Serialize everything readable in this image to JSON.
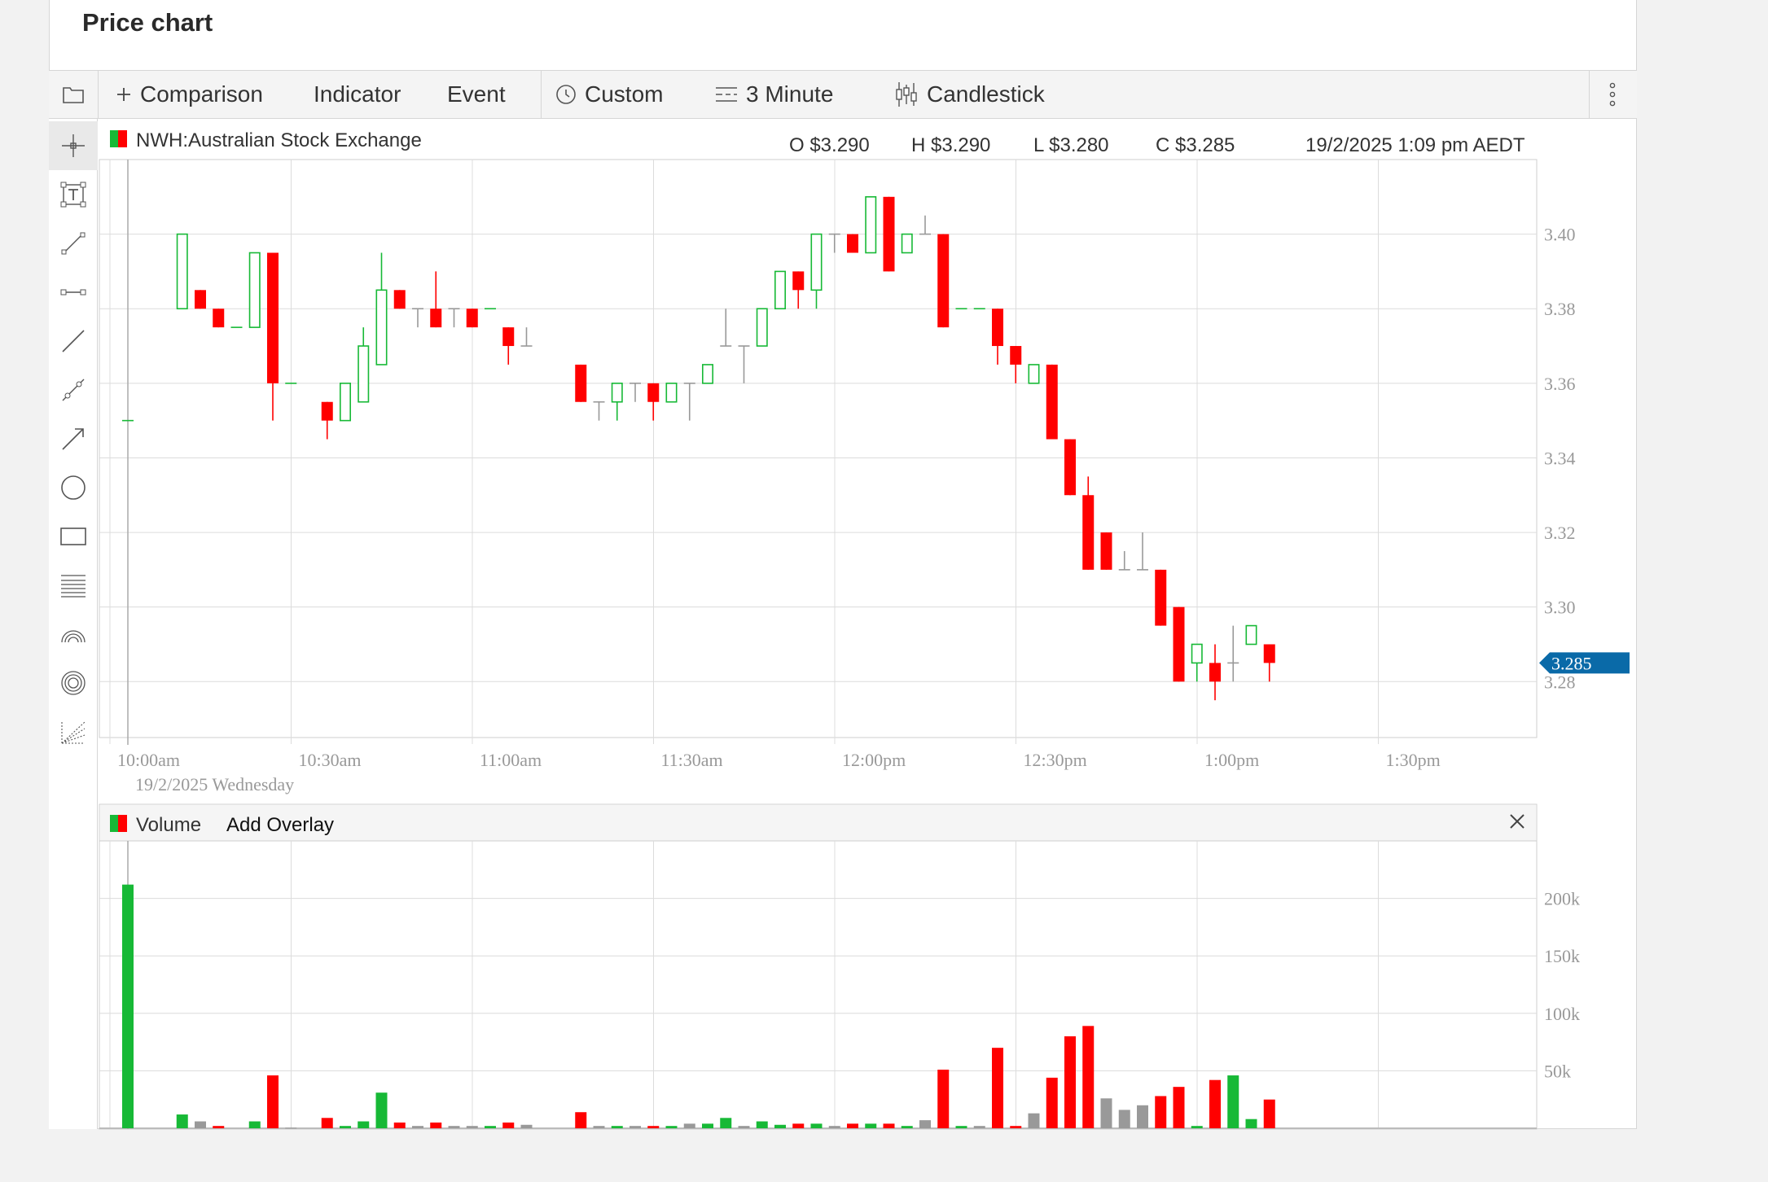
{
  "page": {
    "title": "Price chart"
  },
  "toolbar": {
    "comparison": "Comparison",
    "indicator": "Indicator",
    "event": "Event",
    "custom": "Custom",
    "interval": "3 Minute",
    "chart_type": "Candlestick"
  },
  "tools": [
    "crosshair-icon",
    "annotation-icon",
    "line-segment-icon",
    "horizontal-segment-icon",
    "trend-line-icon",
    "channel-icon",
    "arrow-icon",
    "ellipse-icon",
    "rectangle-icon",
    "fibonacci-retracement-icon",
    "fibonacci-arc-icon",
    "fibonacci-circle-icon",
    "fibonacci-fan-icon"
  ],
  "legend": {
    "symbol": "NWH:Australian Stock Exchange",
    "open": "O $3.290",
    "high": "H $3.290",
    "low": "L $3.280",
    "close": "C $3.285",
    "datetime": "19/2/2025 1:09 pm AEDT"
  },
  "volume_panel": {
    "label": "Volume",
    "add_overlay": "Add Overlay"
  },
  "colors": {
    "up": "#17b936",
    "down": "#ff0000",
    "flat": "#999999",
    "badge": "#0a6aa8"
  },
  "chart_data": [
    {
      "type": "candlestick",
      "title": "NWH:Australian Stock Exchange",
      "ylim": [
        3.265,
        3.42
      ],
      "yticks": [
        "3.28",
        "3.30",
        "3.32",
        "3.34",
        "3.36",
        "3.38",
        "3.40"
      ],
      "xticks": [
        {
          "t": 600,
          "label": "10:00am"
        },
        {
          "t": 630,
          "label": "10:30am"
        },
        {
          "t": 660,
          "label": "11:00am"
        },
        {
          "t": 690,
          "label": "11:30am"
        },
        {
          "t": 720,
          "label": "12:00pm"
        },
        {
          "t": 750,
          "label": "12:30pm"
        },
        {
          "t": 780,
          "label": "1:00pm"
        },
        {
          "t": 810,
          "label": "1:30pm"
        }
      ],
      "date_label": "19/2/2025 Wednesday",
      "last_price": "3.285",
      "last_value": 3.285,
      "candles": [
        {
          "t": 600,
          "o": 3.35,
          "h": 3.35,
          "l": 3.35,
          "c": 3.35
        },
        {
          "t": 609,
          "o": 3.38,
          "h": 3.4,
          "l": 3.38,
          "c": 3.4
        },
        {
          "t": 612,
          "o": 3.385,
          "h": 3.385,
          "l": 3.38,
          "c": 3.38
        },
        {
          "t": 615,
          "o": 3.38,
          "h": 3.38,
          "l": 3.375,
          "c": 3.375
        },
        {
          "t": 618,
          "o": 3.375,
          "h": 3.375,
          "l": 3.375,
          "c": 3.375
        },
        {
          "t": 621,
          "o": 3.375,
          "h": 3.395,
          "l": 3.375,
          "c": 3.395
        },
        {
          "t": 624,
          "o": 3.395,
          "h": 3.395,
          "l": 3.35,
          "c": 3.36
        },
        {
          "t": 627,
          "o": 3.36,
          "h": 3.36,
          "l": 3.36,
          "c": 3.36
        },
        {
          "t": 633,
          "o": 3.355,
          "h": 3.355,
          "l": 3.345,
          "c": 3.35
        },
        {
          "t": 636,
          "o": 3.35,
          "h": 3.36,
          "l": 3.35,
          "c": 3.36
        },
        {
          "t": 639,
          "o": 3.355,
          "h": 3.375,
          "l": 3.355,
          "c": 3.37
        },
        {
          "t": 642,
          "o": 3.365,
          "h": 3.395,
          "l": 3.365,
          "c": 3.385
        },
        {
          "t": 645,
          "o": 3.385,
          "h": 3.385,
          "l": 3.38,
          "c": 3.38
        },
        {
          "t": 648,
          "o": 3.38,
          "h": 3.38,
          "l": 3.375,
          "c": 3.38
        },
        {
          "t": 651,
          "o": 3.38,
          "h": 3.39,
          "l": 3.375,
          "c": 3.375
        },
        {
          "t": 654,
          "o": 3.38,
          "h": 3.38,
          "l": 3.375,
          "c": 3.38
        },
        {
          "t": 657,
          "o": 3.38,
          "h": 3.38,
          "l": 3.375,
          "c": 3.375
        },
        {
          "t": 660,
          "o": 3.38,
          "h": 3.38,
          "l": 3.38,
          "c": 3.38
        },
        {
          "t": 663,
          "o": 3.375,
          "h": 3.375,
          "l": 3.365,
          "c": 3.37
        },
        {
          "t": 666,
          "o": 3.37,
          "h": 3.375,
          "l": 3.37,
          "c": 3.37
        },
        {
          "t": 675,
          "o": 3.365,
          "h": 3.365,
          "l": 3.355,
          "c": 3.355
        },
        {
          "t": 678,
          "o": 3.355,
          "h": 3.355,
          "l": 3.35,
          "c": 3.355
        },
        {
          "t": 681,
          "o": 3.355,
          "h": 3.36,
          "l": 3.35,
          "c": 3.36
        },
        {
          "t": 684,
          "o": 3.36,
          "h": 3.36,
          "l": 3.355,
          "c": 3.36
        },
        {
          "t": 687,
          "o": 3.36,
          "h": 3.36,
          "l": 3.35,
          "c": 3.355
        },
        {
          "t": 690,
          "o": 3.355,
          "h": 3.36,
          "l": 3.355,
          "c": 3.36
        },
        {
          "t": 693,
          "o": 3.36,
          "h": 3.36,
          "l": 3.35,
          "c": 3.36
        },
        {
          "t": 696,
          "o": 3.36,
          "h": 3.365,
          "l": 3.36,
          "c": 3.365
        },
        {
          "t": 699,
          "o": 3.37,
          "h": 3.38,
          "l": 3.37,
          "c": 3.37
        },
        {
          "t": 702,
          "o": 3.37,
          "h": 3.37,
          "l": 3.36,
          "c": 3.37
        },
        {
          "t": 705,
          "o": 3.37,
          "h": 3.38,
          "l": 3.37,
          "c": 3.38
        },
        {
          "t": 708,
          "o": 3.38,
          "h": 3.39,
          "l": 3.38,
          "c": 3.39
        },
        {
          "t": 711,
          "o": 3.39,
          "h": 3.39,
          "l": 3.38,
          "c": 3.385
        },
        {
          "t": 714,
          "o": 3.385,
          "h": 3.4,
          "l": 3.38,
          "c": 3.4
        },
        {
          "t": 717,
          "o": 3.4,
          "h": 3.4,
          "l": 3.395,
          "c": 3.4
        },
        {
          "t": 720,
          "o": 3.4,
          "h": 3.4,
          "l": 3.395,
          "c": 3.395
        },
        {
          "t": 723,
          "o": 3.395,
          "h": 3.41,
          "l": 3.395,
          "c": 3.41
        },
        {
          "t": 726,
          "o": 3.41,
          "h": 3.41,
          "l": 3.39,
          "c": 3.39
        },
        {
          "t": 729,
          "o": 3.395,
          "h": 3.4,
          "l": 3.395,
          "c": 3.4
        },
        {
          "t": 732,
          "o": 3.4,
          "h": 3.405,
          "l": 3.4,
          "c": 3.4
        },
        {
          "t": 735,
          "o": 3.4,
          "h": 3.4,
          "l": 3.375,
          "c": 3.375
        },
        {
          "t": 738,
          "o": 3.38,
          "h": 3.38,
          "l": 3.38,
          "c": 3.38
        },
        {
          "t": 741,
          "o": 3.38,
          "h": 3.38,
          "l": 3.38,
          "c": 3.38
        },
        {
          "t": 744,
          "o": 3.38,
          "h": 3.38,
          "l": 3.365,
          "c": 3.37
        },
        {
          "t": 747,
          "o": 3.37,
          "h": 3.37,
          "l": 3.36,
          "c": 3.365
        },
        {
          "t": 750,
          "o": 3.36,
          "h": 3.365,
          "l": 3.36,
          "c": 3.365
        },
        {
          "t": 753,
          "o": 3.365,
          "h": 3.365,
          "l": 3.345,
          "c": 3.345
        },
        {
          "t": 756,
          "o": 3.345,
          "h": 3.345,
          "l": 3.33,
          "c": 3.33
        },
        {
          "t": 759,
          "o": 3.33,
          "h": 3.335,
          "l": 3.31,
          "c": 3.31
        },
        {
          "t": 762,
          "o": 3.32,
          "h": 3.32,
          "l": 3.31,
          "c": 3.31
        },
        {
          "t": 765,
          "o": 3.31,
          "h": 3.315,
          "l": 3.31,
          "c": 3.31
        },
        {
          "t": 768,
          "o": 3.31,
          "h": 3.32,
          "l": 3.31,
          "c": 3.31
        },
        {
          "t": 771,
          "o": 3.31,
          "h": 3.31,
          "l": 3.295,
          "c": 3.295
        },
        {
          "t": 774,
          "o": 3.3,
          "h": 3.3,
          "l": 3.28,
          "c": 3.28
        },
        {
          "t": 777,
          "o": 3.285,
          "h": 3.29,
          "l": 3.28,
          "c": 3.29
        },
        {
          "t": 780,
          "o": 3.285,
          "h": 3.29,
          "l": 3.275,
          "c": 3.28
        },
        {
          "t": 783,
          "o": 3.285,
          "h": 3.295,
          "l": 3.28,
          "c": 3.285
        },
        {
          "t": 786,
          "o": 3.29,
          "h": 3.295,
          "l": 3.29,
          "c": 3.295
        },
        {
          "t": 789,
          "o": 3.29,
          "h": 3.29,
          "l": 3.28,
          "c": 3.285
        }
      ]
    },
    {
      "type": "bar",
      "title": "Volume",
      "ylim": [
        0,
        250000
      ],
      "yticks": [
        {
          "v": 50000,
          "label": "50k"
        },
        {
          "v": 100000,
          "label": "100k"
        },
        {
          "v": 150000,
          "label": "150k"
        },
        {
          "v": 200000,
          "label": "200k"
        }
      ],
      "bars": [
        {
          "t": 600,
          "v": 212000,
          "d": "up"
        },
        {
          "t": 609,
          "v": 12000,
          "d": "up"
        },
        {
          "t": 612,
          "v": 6000,
          "d": "flat"
        },
        {
          "t": 615,
          "v": 2000,
          "d": "down"
        },
        {
          "t": 621,
          "v": 6000,
          "d": "up"
        },
        {
          "t": 624,
          "v": 46000,
          "d": "down"
        },
        {
          "t": 627,
          "v": 500,
          "d": "flat"
        },
        {
          "t": 633,
          "v": 9000,
          "d": "down"
        },
        {
          "t": 636,
          "v": 2000,
          "d": "up"
        },
        {
          "t": 639,
          "v": 6000,
          "d": "up"
        },
        {
          "t": 642,
          "v": 31000,
          "d": "up"
        },
        {
          "t": 645,
          "v": 5000,
          "d": "down"
        },
        {
          "t": 648,
          "v": 2000,
          "d": "flat"
        },
        {
          "t": 651,
          "v": 5000,
          "d": "down"
        },
        {
          "t": 654,
          "v": 2000,
          "d": "flat"
        },
        {
          "t": 657,
          "v": 2000,
          "d": "flat"
        },
        {
          "t": 660,
          "v": 2000,
          "d": "up"
        },
        {
          "t": 663,
          "v": 5000,
          "d": "down"
        },
        {
          "t": 666,
          "v": 3000,
          "d": "flat"
        },
        {
          "t": 675,
          "v": 14000,
          "d": "down"
        },
        {
          "t": 678,
          "v": 2000,
          "d": "flat"
        },
        {
          "t": 681,
          "v": 2000,
          "d": "up"
        },
        {
          "t": 684,
          "v": 2000,
          "d": "flat"
        },
        {
          "t": 687,
          "v": 2000,
          "d": "down"
        },
        {
          "t": 690,
          "v": 2000,
          "d": "up"
        },
        {
          "t": 693,
          "v": 4000,
          "d": "flat"
        },
        {
          "t": 696,
          "v": 4000,
          "d": "up"
        },
        {
          "t": 699,
          "v": 9000,
          "d": "up"
        },
        {
          "t": 702,
          "v": 2000,
          "d": "flat"
        },
        {
          "t": 705,
          "v": 6000,
          "d": "up"
        },
        {
          "t": 708,
          "v": 3000,
          "d": "up"
        },
        {
          "t": 711,
          "v": 4000,
          "d": "down"
        },
        {
          "t": 714,
          "v": 4000,
          "d": "up"
        },
        {
          "t": 717,
          "v": 2000,
          "d": "flat"
        },
        {
          "t": 720,
          "v": 4000,
          "d": "down"
        },
        {
          "t": 723,
          "v": 4000,
          "d": "up"
        },
        {
          "t": 726,
          "v": 4000,
          "d": "down"
        },
        {
          "t": 729,
          "v": 2000,
          "d": "up"
        },
        {
          "t": 732,
          "v": 7000,
          "d": "flat"
        },
        {
          "t": 735,
          "v": 51000,
          "d": "down"
        },
        {
          "t": 738,
          "v": 2000,
          "d": "up"
        },
        {
          "t": 741,
          "v": 2000,
          "d": "flat"
        },
        {
          "t": 744,
          "v": 70000,
          "d": "down"
        },
        {
          "t": 747,
          "v": 2000,
          "d": "down"
        },
        {
          "t": 750,
          "v": 13000,
          "d": "flat"
        },
        {
          "t": 753,
          "v": 44000,
          "d": "down"
        },
        {
          "t": 756,
          "v": 80000,
          "d": "down"
        },
        {
          "t": 759,
          "v": 89000,
          "d": "down"
        },
        {
          "t": 762,
          "v": 26000,
          "d": "flat"
        },
        {
          "t": 765,
          "v": 16000,
          "d": "flat"
        },
        {
          "t": 768,
          "v": 20000,
          "d": "flat"
        },
        {
          "t": 771,
          "v": 28000,
          "d": "down"
        },
        {
          "t": 774,
          "v": 36000,
          "d": "down"
        },
        {
          "t": 777,
          "v": 2000,
          "d": "up"
        },
        {
          "t": 780,
          "v": 42000,
          "d": "down"
        },
        {
          "t": 783,
          "v": 46000,
          "d": "up"
        },
        {
          "t": 786,
          "v": 8000,
          "d": "up"
        },
        {
          "t": 789,
          "v": 25000,
          "d": "down"
        }
      ]
    }
  ]
}
